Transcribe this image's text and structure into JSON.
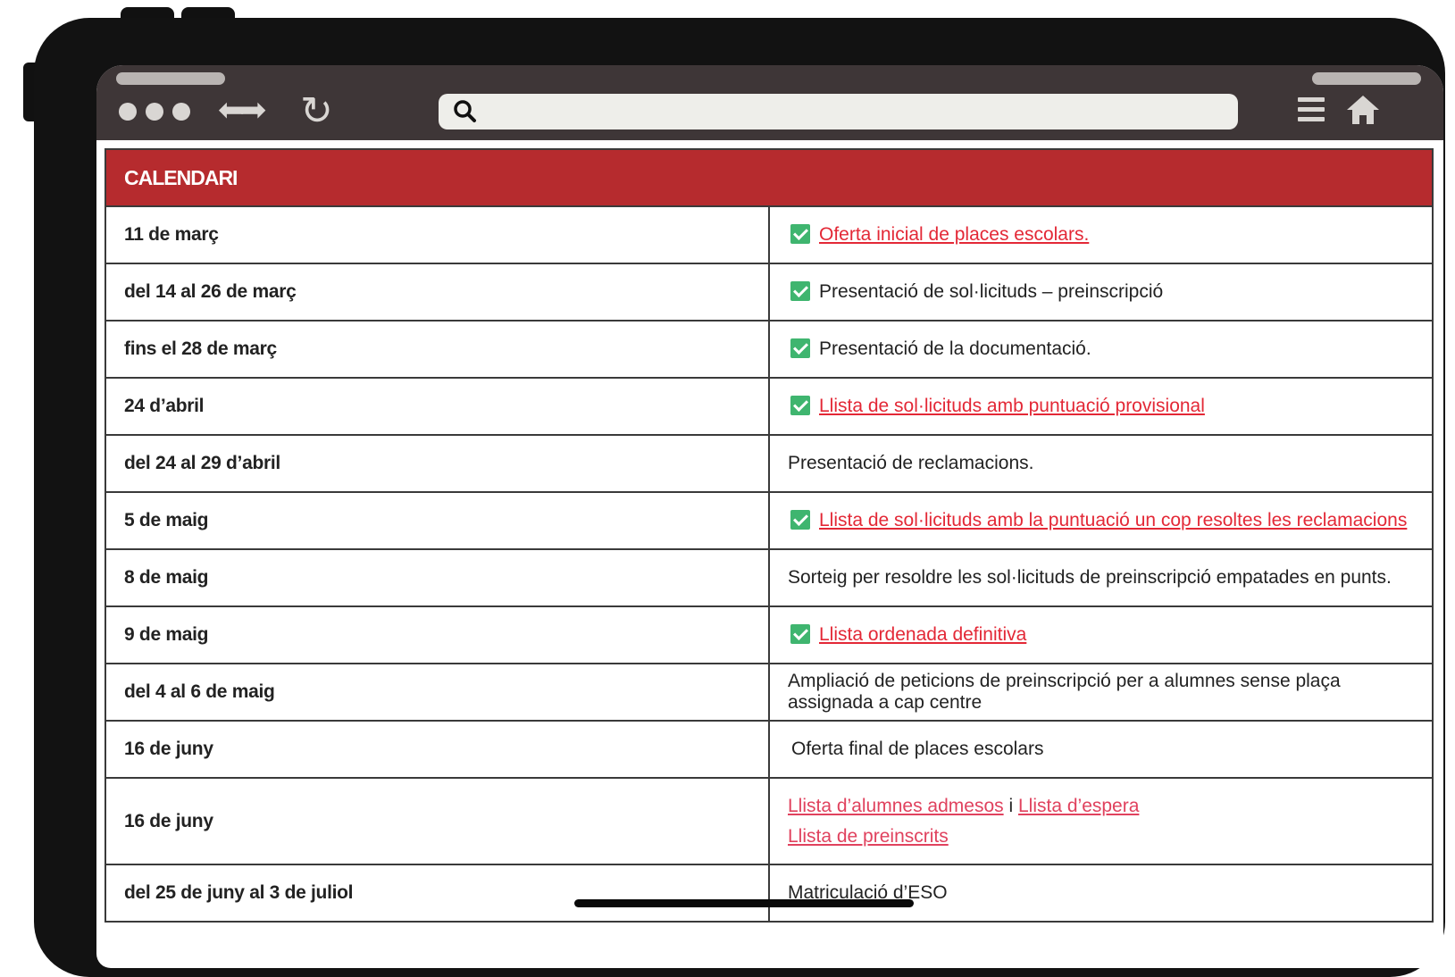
{
  "browser": {
    "search_placeholder": ""
  },
  "calendar": {
    "title": "CALENDARI",
    "rows": [
      {
        "date": "11 de març",
        "text": "Oferta inicial de places escolars."
      },
      {
        "date": "del 14 al 26 de març",
        "text": "Presentació de sol·licituds – preinscripció"
      },
      {
        "date": "fins el 28 de març",
        "text": "Presentació de la documentació."
      },
      {
        "date": "24 d’abril",
        "text": "Llista de sol·licituds amb puntuació provisional"
      },
      {
        "date": "del 24 al 29 d’abril",
        "text": "Presentació de reclamacions."
      },
      {
        "date": "5 de maig",
        "text": "Llista de sol·licituds amb la puntuació un cop resoltes les reclamacions"
      },
      {
        "date": "8 de maig",
        "text": "Sorteig per resoldre les sol·licituds de preinscripció empatades en punts."
      },
      {
        "date": "9 de maig",
        "text": "Llista ordenada definitiva"
      },
      {
        "date": "del 4 al 6 de maig",
        "text": "Ampliació de peticions de preinscripció per a alumnes sense plaça assignada a cap centre"
      },
      {
        "date": "16 de juny",
        "text": "Oferta final de places escolars"
      },
      {
        "date": "16 de juny",
        "link_admesos": "Llista d’alumnes admesos",
        "connector": "i",
        "link_espera": "Llista d’espera",
        "link_preinscrits": "Llista de preinscrits"
      },
      {
        "date": "del 25 de juny al 3 de juliol",
        "text": "Matriculació d’ESO"
      }
    ]
  },
  "colors": {
    "header_red": "#b62b2e",
    "link_red": "#e32836",
    "check_green": "#3fb56f",
    "toolbar": "#3e3637"
  }
}
